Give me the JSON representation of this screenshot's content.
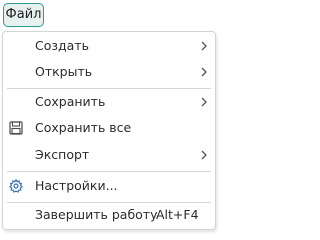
{
  "menubar": {
    "file_label": "Файл"
  },
  "menu": {
    "items": [
      {
        "label": "Создать"
      },
      {
        "label": "Открыть"
      },
      {
        "label": "Сохранить"
      },
      {
        "label": "Сохранить все",
        "icon": "save-all-icon"
      },
      {
        "label": "Экспорт"
      },
      {
        "label": "Настройки...",
        "icon": "gear-icon"
      },
      {
        "label": "Завершить работу",
        "shortcut": "Alt+F4"
      }
    ]
  },
  "colors": {
    "accent": "#2a9d8f",
    "accent_bg": "#e6f1f0",
    "separator": "#d6d6d6",
    "icon": "#4a4a4a",
    "gear_icon": "#3b6fb6"
  }
}
